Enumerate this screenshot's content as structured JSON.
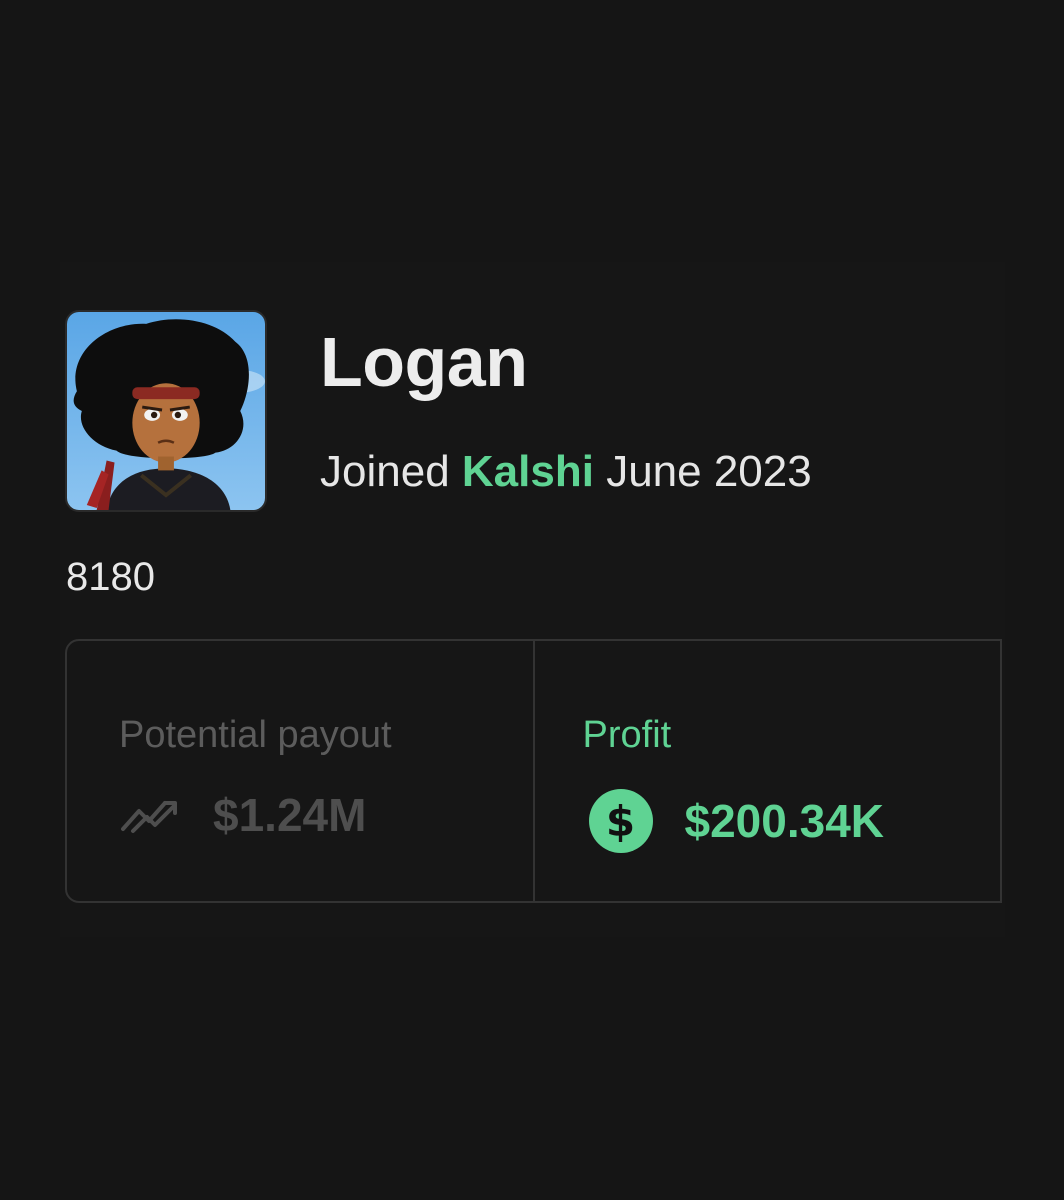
{
  "profile": {
    "name": "Logan",
    "joined_prefix": "Joined",
    "joined_brand": "Kalshi",
    "joined_date": "June 2023",
    "score": "8180"
  },
  "stats": {
    "potential_payout": {
      "label": "Potential payout",
      "value": "$1.24M",
      "icon": "trend-up-icon"
    },
    "profit": {
      "label": "Profit",
      "value": "$200.34K",
      "icon": "dollar-circle-icon",
      "symbol": "$"
    }
  },
  "colors": {
    "background": "#151515",
    "accent": "#5fd393",
    "muted": "#5c5c5c",
    "text": "#ededed",
    "border": "#333333"
  }
}
